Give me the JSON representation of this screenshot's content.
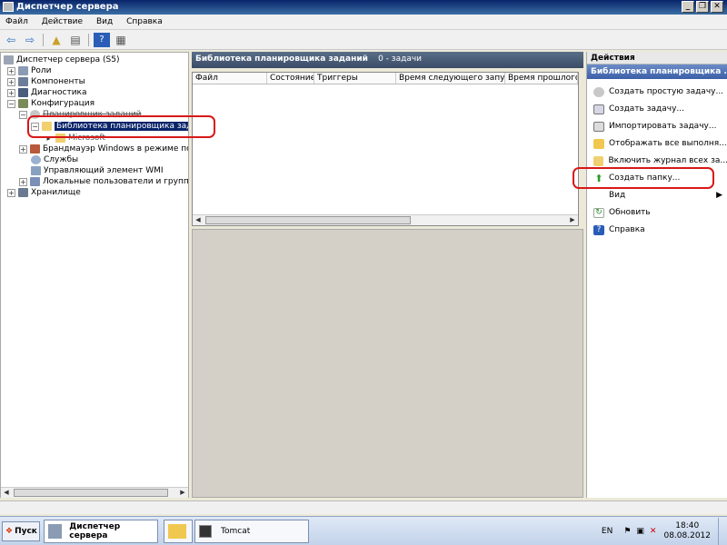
{
  "window": {
    "title": "Диспетчер сервера"
  },
  "menu": [
    "Файл",
    "Действие",
    "Вид",
    "Справка"
  ],
  "tree": {
    "items": [
      {
        "label": "Диспетчер сервера (S5)"
      },
      {
        "label": "Роли"
      },
      {
        "label": "Компоненты"
      },
      {
        "label": "Диагностика"
      },
      {
        "label": "Конфигурация"
      },
      {
        "label": "Планировщик заданий"
      },
      {
        "label": "Библиотека планировщика заданий"
      },
      {
        "label": "Microsoft"
      },
      {
        "label": "Брандмауэр Windows в режиме повыше"
      },
      {
        "label": "Службы"
      },
      {
        "label": "Управляющий элемент WMI"
      },
      {
        "label": "Локальные пользователи и группы"
      },
      {
        "label": "Хранилище"
      }
    ]
  },
  "center": {
    "title": "Библиотека планировщика заданий",
    "count": "0 - задачи",
    "columns": [
      "Файл",
      "Состояние",
      "Триггеры",
      "Время следующего запуска",
      "Время прошлого за"
    ]
  },
  "actions": {
    "title": "Действия",
    "subtitle": "Библиотека планировщика ...",
    "items": [
      {
        "label": "Создать простую задачу..."
      },
      {
        "label": "Создать задачу..."
      },
      {
        "label": "Импортировать задачу..."
      },
      {
        "label": "Отображать все выполня..."
      },
      {
        "label": "Включить журнал всех за..."
      },
      {
        "label": "Создать папку..."
      },
      {
        "label": "Вид"
      },
      {
        "label": "Обновить"
      },
      {
        "label": "Справка"
      }
    ]
  },
  "taskbar": {
    "start": "Пуск",
    "tasks": [
      "Диспетчер сервера",
      "Tomcat"
    ],
    "lang": "EN",
    "time": "18:40",
    "date": "08.08.2012"
  }
}
